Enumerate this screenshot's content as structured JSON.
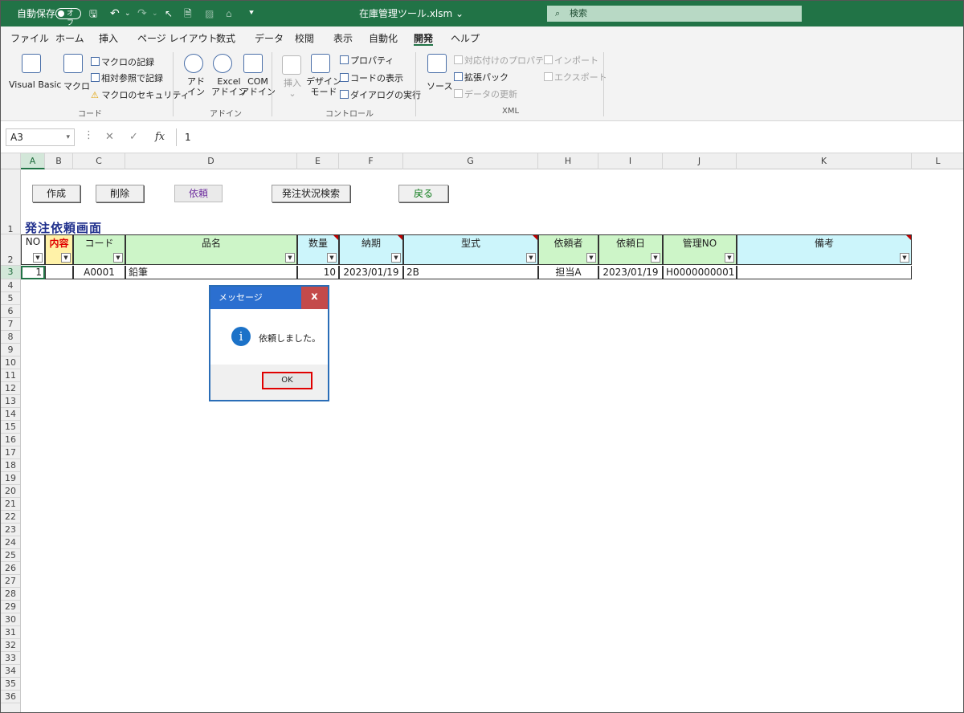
{
  "titlebar": {
    "autosave_label": "自動保存",
    "autosave_state": "オフ",
    "filename": "在庫管理ツール.xlsm",
    "search_placeholder": "検索",
    "brand_color": "#217346"
  },
  "menu": [
    "ファイル",
    "ホーム",
    "挿入",
    "ページ レイアウト",
    "数式",
    "データ",
    "校閲",
    "表示",
    "自動化",
    "開発",
    "ヘルプ"
  ],
  "ribbon": {
    "code": {
      "visual_basic": "Visual Basic",
      "macro": "マクロ",
      "record_macro": "マクロの記録",
      "relative_ref": "相対参照で記録",
      "macro_security": "マクロのセキュリティ",
      "label": "コード"
    },
    "addins": {
      "addin_1": "アド",
      "addin_2": "イン",
      "excel_addin_1": "Excel",
      "excel_addin_2": "アドイン",
      "com_addin_1": "COM",
      "com_addin_2": "アドイン",
      "label": "アドイン"
    },
    "controls": {
      "insert": "挿入",
      "design_mode_1": "デザイン",
      "design_mode_2": "モード",
      "properties": "プロパティ",
      "view_code": "コードの表示",
      "run_dialog": "ダイアログの実行",
      "label": "コントロール"
    },
    "xml": {
      "source": "ソース",
      "map_properties": "対応付けのプロパティ",
      "expansion_packs": "拡張パック",
      "refresh_data": "データの更新",
      "import": "インポート",
      "export": "エクスポート",
      "label": "XML"
    }
  },
  "formula_bar": {
    "name_box": "A3",
    "cancel": "✕",
    "enter": "✓",
    "fx": "fx",
    "value": "1"
  },
  "columns": [
    "A",
    "B",
    "C",
    "D",
    "E",
    "F",
    "G",
    "H",
    "I",
    "J",
    "K",
    "L"
  ],
  "rows": [
    "1",
    "2",
    "3",
    "4",
    "5",
    "6",
    "7",
    "8",
    "9",
    "10",
    "11",
    "12",
    "13",
    "14",
    "15",
    "16",
    "17",
    "18",
    "19",
    "20",
    "21",
    "22",
    "23",
    "24",
    "25",
    "26",
    "27",
    "28",
    "29",
    "30",
    "31",
    "32",
    "33",
    "34",
    "35",
    "36"
  ],
  "sheet": {
    "buttons": {
      "create": "作成",
      "delete": "削除",
      "request": "依頼",
      "status_search": "発注状況検索",
      "back": "戻る"
    },
    "title": "発注依頼画面",
    "headers": {
      "no": "NO",
      "content": "内容",
      "code": "コード",
      "item_name": "品名",
      "quantity": "数量",
      "delivery": "納期",
      "model": "型式",
      "requester": "依頼者",
      "request_date": "依頼日",
      "mgmt_no": "管理NO",
      "remarks": "備考"
    },
    "row": {
      "no": "1",
      "content": "",
      "code": "A0001",
      "item_name": "鉛筆",
      "quantity": "10",
      "delivery": "2023/01/19",
      "model": "2B",
      "requester": "担当A",
      "request_date": "2023/01/19",
      "mgmt_no": "H0000000001",
      "remarks": ""
    }
  },
  "dialog": {
    "title": "メッセージ",
    "close": "x",
    "icon": "i",
    "message": "依頼しました。",
    "ok": "OK"
  }
}
